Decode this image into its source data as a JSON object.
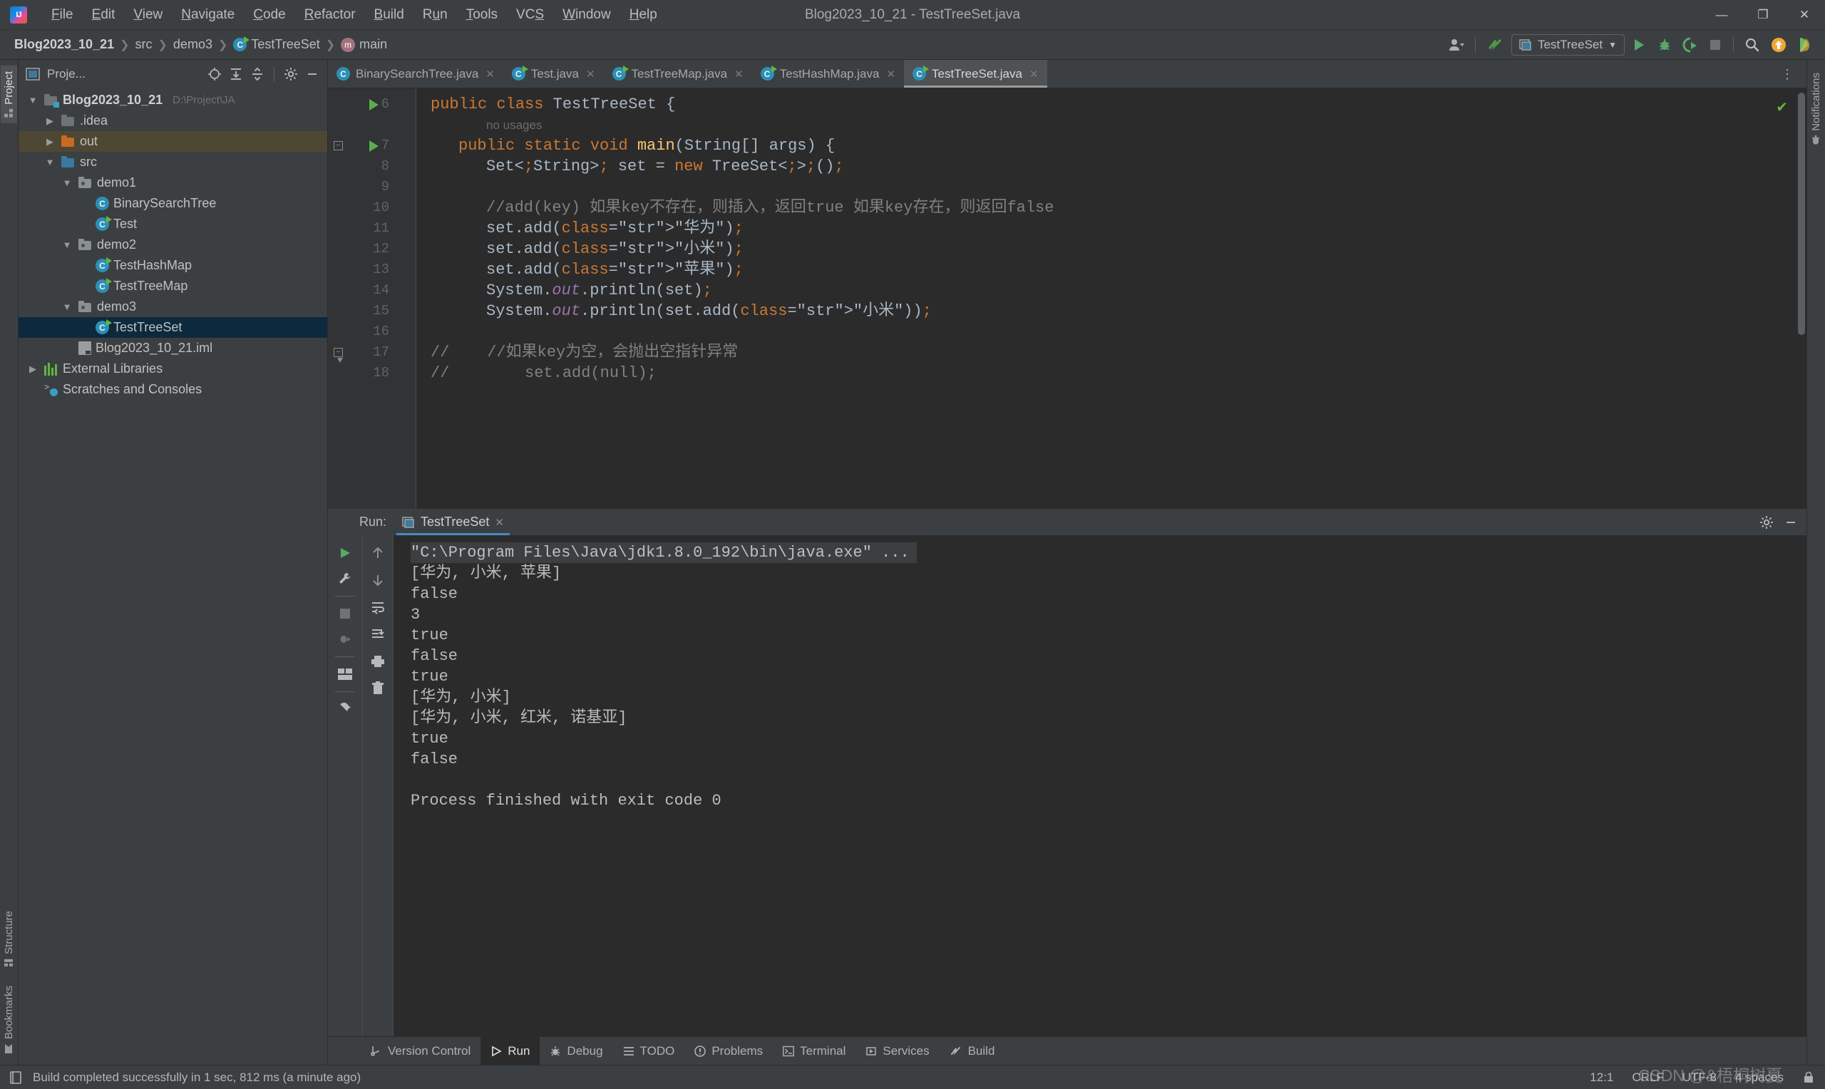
{
  "window": {
    "title": "Blog2023_10_21 - TestTreeSet.java",
    "logo_icon": "intellij-idea-logo",
    "minimize_label": "—",
    "maximize_label": "❐",
    "close_label": "✕"
  },
  "menubar": [
    {
      "label": "File",
      "mnemonic": "F"
    },
    {
      "label": "Edit",
      "mnemonic": "E"
    },
    {
      "label": "View",
      "mnemonic": "V"
    },
    {
      "label": "Navigate",
      "mnemonic": "N"
    },
    {
      "label": "Code",
      "mnemonic": "C"
    },
    {
      "label": "Refactor",
      "mnemonic": "R"
    },
    {
      "label": "Build",
      "mnemonic": "B"
    },
    {
      "label": "Run",
      "mnemonic": "u"
    },
    {
      "label": "Tools",
      "mnemonic": "T"
    },
    {
      "label": "VCS",
      "mnemonic": "S"
    },
    {
      "label": "Window",
      "mnemonic": "W"
    },
    {
      "label": "Help",
      "mnemonic": "H"
    }
  ],
  "breadcrumbs": [
    {
      "label": "Blog2023_10_21",
      "icon": "none",
      "bold": true
    },
    {
      "label": "src",
      "icon": "none",
      "bold": false
    },
    {
      "label": "demo3",
      "icon": "none",
      "bold": false
    },
    {
      "label": "TestTreeSet",
      "icon": "class-icon",
      "bold": false
    },
    {
      "label": "main",
      "icon": "method-icon",
      "bold": false
    }
  ],
  "toolbar": {
    "account_icon": "user-avatar-icon",
    "updates_icon": "vcs-update-icon",
    "run_config_name": "TestTreeSet",
    "run_config_icon": "application-config-icon",
    "run_icon": "run-button",
    "debug_icon": "debug-button",
    "run_coverage_icon": "run-with-coverage-button",
    "stop_icon": "stop-button",
    "search_icon": "search-everywhere-icon",
    "notifications_icon": "update-available-icon",
    "ide_helper_icon": "ide-assistant-icon"
  },
  "left_strip": {
    "project_tab": "Project",
    "structure_tab": "Structure",
    "bookmarks_tab": "Bookmarks"
  },
  "project_panel": {
    "title": "Proje...",
    "icons": [
      "select-opened-file-icon",
      "expand-all-icon",
      "collapse-all-icon",
      "settings-gear-icon",
      "hide-panel-icon"
    ],
    "tree": [
      {
        "label": "Blog2023_10_21",
        "path": "D:\\Project\\JA",
        "icon": "project-folder-icon",
        "indent": 0,
        "arrow": "expanded",
        "bold": true,
        "state": "none"
      },
      {
        "label": ".idea",
        "path": "",
        "icon": "folder-icon",
        "indent": 1,
        "arrow": "collapsed",
        "bold": false,
        "state": "none"
      },
      {
        "label": "out",
        "path": "",
        "icon": "folder-excluded-icon",
        "indent": 1,
        "arrow": "collapsed",
        "bold": false,
        "state": "inactive-selection"
      },
      {
        "label": "src",
        "path": "",
        "icon": "source-folder-icon",
        "indent": 1,
        "arrow": "expanded",
        "bold": false,
        "state": "none"
      },
      {
        "label": "demo1",
        "path": "",
        "icon": "package-icon",
        "indent": 2,
        "arrow": "expanded",
        "bold": false,
        "state": "none"
      },
      {
        "label": "BinarySearchTree",
        "path": "",
        "icon": "java-class-icon",
        "indent": 3,
        "arrow": "none",
        "bold": false,
        "state": "none"
      },
      {
        "label": "Test",
        "path": "",
        "icon": "java-runnable-class-icon",
        "indent": 3,
        "arrow": "none",
        "bold": false,
        "state": "none"
      },
      {
        "label": "demo2",
        "path": "",
        "icon": "package-icon",
        "indent": 2,
        "arrow": "expanded",
        "bold": false,
        "state": "none"
      },
      {
        "label": "TestHashMap",
        "path": "",
        "icon": "java-runnable-class-icon",
        "indent": 3,
        "arrow": "none",
        "bold": false,
        "state": "none"
      },
      {
        "label": "TestTreeMap",
        "path": "",
        "icon": "java-runnable-class-icon",
        "indent": 3,
        "arrow": "none",
        "bold": false,
        "state": "none"
      },
      {
        "label": "demo3",
        "path": "",
        "icon": "package-icon",
        "indent": 2,
        "arrow": "expanded",
        "bold": false,
        "state": "none"
      },
      {
        "label": "TestTreeSet",
        "path": "",
        "icon": "java-runnable-class-icon",
        "indent": 3,
        "arrow": "none",
        "bold": false,
        "state": "active-selection"
      },
      {
        "label": "Blog2023_10_21.iml",
        "path": "",
        "icon": "iml-file-icon",
        "indent": 2,
        "arrow": "none",
        "bold": false,
        "state": "none"
      },
      {
        "label": "External Libraries",
        "path": "",
        "icon": "libraries-icon",
        "indent": 0,
        "arrow": "collapsed",
        "bold": false,
        "state": "none"
      },
      {
        "label": "Scratches and Consoles",
        "path": "",
        "icon": "scratches-icon",
        "indent": 0,
        "arrow": "none",
        "bold": false,
        "state": "none"
      }
    ]
  },
  "editor_tabs": [
    {
      "label": "BinarySearchTree.java",
      "icon": "java-class-icon",
      "active": false
    },
    {
      "label": "Test.java",
      "icon": "java-runnable-class-icon",
      "active": false
    },
    {
      "label": "TestTreeMap.java",
      "icon": "java-runnable-class-icon",
      "active": false
    },
    {
      "label": "TestHashMap.java",
      "icon": "java-runnable-class-icon",
      "active": false
    },
    {
      "label": "TestTreeSet.java",
      "icon": "java-runnable-class-icon",
      "active": true
    }
  ],
  "editor": {
    "inspection_status_icon": "inspections-ok-icon",
    "lines": [
      {
        "num": "6",
        "runmark": true,
        "fold": "none",
        "indent": 0,
        "text": "public class TestTreeSet {",
        "kind": "code"
      },
      {
        "num": "",
        "runmark": false,
        "fold": "none",
        "indent": 2,
        "text": "no usages",
        "kind": "inlay"
      },
      {
        "num": "7",
        "runmark": true,
        "fold": "minus",
        "indent": 1,
        "text": "public static void main(String[] args) {",
        "kind": "code"
      },
      {
        "num": "8",
        "runmark": false,
        "fold": "none",
        "indent": 2,
        "text": "Set<String> set = new TreeSet<>();",
        "kind": "code"
      },
      {
        "num": "9",
        "runmark": false,
        "fold": "none",
        "indent": 0,
        "text": "",
        "kind": "code"
      },
      {
        "num": "10",
        "runmark": false,
        "fold": "none",
        "indent": 2,
        "text": "//add(key) 如果key不存在，则插入，返回true 如果key存在，则返回false",
        "kind": "comment"
      },
      {
        "num": "11",
        "runmark": false,
        "fold": "none",
        "indent": 2,
        "text": "set.add(\"华为\");",
        "kind": "code"
      },
      {
        "num": "12",
        "runmark": false,
        "fold": "none",
        "indent": 2,
        "text": "set.add(\"小米\");",
        "kind": "code"
      },
      {
        "num": "13",
        "runmark": false,
        "fold": "none",
        "indent": 2,
        "text": "set.add(\"苹果\");",
        "kind": "code"
      },
      {
        "num": "14",
        "runmark": false,
        "fold": "none",
        "indent": 2,
        "text": "System.out.println(set);",
        "kind": "code"
      },
      {
        "num": "15",
        "runmark": false,
        "fold": "none",
        "indent": 2,
        "text": "System.out.println(set.add(\"小米\"));",
        "kind": "code"
      },
      {
        "num": "16",
        "runmark": false,
        "fold": "none",
        "indent": 0,
        "text": "",
        "kind": "code"
      },
      {
        "num": "17",
        "runmark": false,
        "fold": "down",
        "indent": 0,
        "text": "//    //如果key为空，会抛出空指针异常",
        "kind": "comment"
      },
      {
        "num": "18",
        "runmark": false,
        "fold": "none",
        "indent": 0,
        "text": "//        set.add(null);",
        "kind": "comment"
      }
    ]
  },
  "run_panel": {
    "label": "Run:",
    "tab_label": "TestTreeSet",
    "tab_icon": "run-configuration-icon",
    "close_tab_label": "✕",
    "settings_icon": "settings-gear-icon",
    "hide_icon": "hide-panel-icon",
    "tools_left": [
      "rerun-icon",
      "modify-run-configuration-icon",
      "stop-icon",
      "thread-dump-icon",
      "layout-icon",
      "pin-tab-icon"
    ],
    "tools_right": [
      "scroll-up-icon",
      "scroll-down-icon",
      "soft-wrap-icon",
      "scroll-to-end-icon",
      "print-icon",
      "clear-all-icon"
    ],
    "console_lines": [
      {
        "text": "\"C:\\Program Files\\Java\\jdk1.8.0_192\\bin\\java.exe\" ...",
        "kind": "command"
      },
      {
        "text": "[华为, 小米, 苹果]",
        "kind": "out"
      },
      {
        "text": "false",
        "kind": "out"
      },
      {
        "text": "3",
        "kind": "out"
      },
      {
        "text": "true",
        "kind": "out"
      },
      {
        "text": "false",
        "kind": "out"
      },
      {
        "text": "true",
        "kind": "out"
      },
      {
        "text": "[华为, 小米]",
        "kind": "out"
      },
      {
        "text": "[华为, 小米, 红米, 诺基亚]",
        "kind": "out"
      },
      {
        "text": "true",
        "kind": "out"
      },
      {
        "text": "false",
        "kind": "out"
      },
      {
        "text": "",
        "kind": "out"
      },
      {
        "text": "Process finished with exit code 0",
        "kind": "out"
      }
    ]
  },
  "tool_tabs": [
    {
      "label": "Version Control",
      "icon": "version-control-icon",
      "active": false
    },
    {
      "label": "Run",
      "icon": "run-icon",
      "active": true
    },
    {
      "label": "Debug",
      "icon": "debug-icon",
      "active": false
    },
    {
      "label": "TODO",
      "icon": "todo-icon",
      "active": false
    },
    {
      "label": "Problems",
      "icon": "problems-icon",
      "active": false
    },
    {
      "label": "Terminal",
      "icon": "terminal-icon",
      "active": false
    },
    {
      "label": "Services",
      "icon": "services-icon",
      "active": false
    },
    {
      "label": "Build",
      "icon": "build-icon",
      "active": false
    }
  ],
  "statusbar": {
    "message_icon": "build-status-icon",
    "message": "Build completed successfully in 1 sec, 812 ms (a minute ago)",
    "caret_position": "12:1",
    "line_separator": "CRLF",
    "encoding": "UTF-8",
    "indent": "4 spaces",
    "lock_icon": "read-only-toggle-icon"
  },
  "right_strip": {
    "notifications_tab": "Notifications"
  },
  "watermark": "CSDN @&梧桐树夏",
  "colors": {
    "background": "#3c3f41",
    "editor_bg": "#2b2b2b",
    "accent_blue": "#4a88c7",
    "selection_active": "#0d293e",
    "selection_inactive": "#4e4733",
    "keyword_orange": "#cc7832",
    "string_green": "#6a8759",
    "number_blue": "#6897bb",
    "comment_grey": "#808080",
    "method_yellow": "#ffc66d",
    "field_purple": "#9876aa",
    "run_green": "#5bad4f",
    "folder_orange": "#c96a21",
    "class_icon_blue": "#2d8fb5"
  }
}
